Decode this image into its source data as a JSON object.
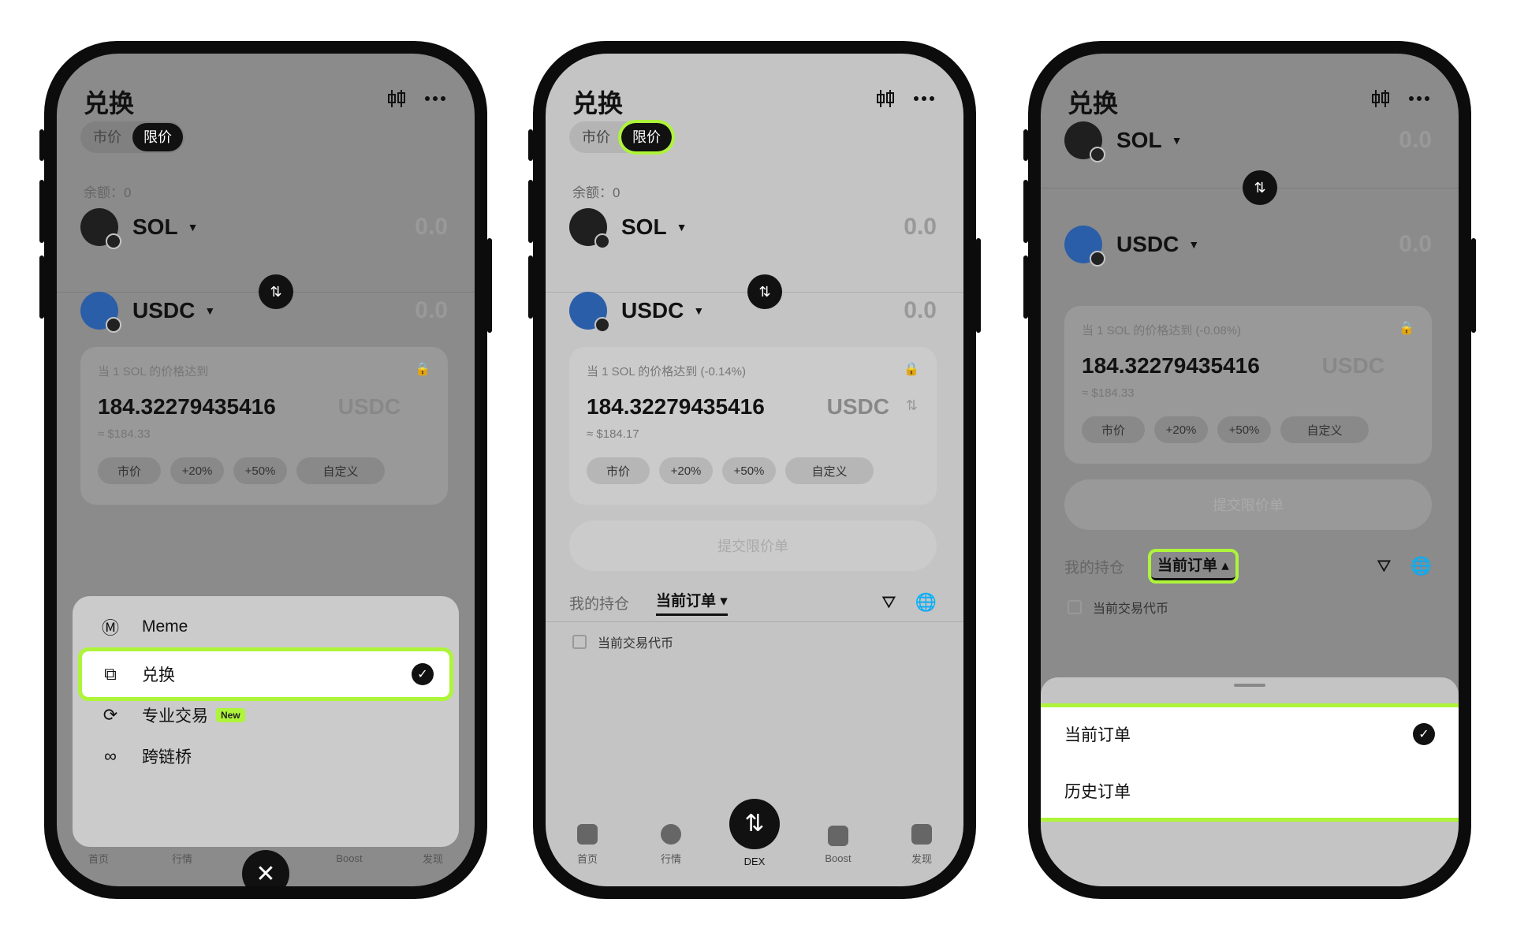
{
  "colors": {
    "highlight": "#aef43a",
    "dark": "#111111",
    "screen_bg": "#c4c4c4"
  },
  "header": {
    "title": "兑换",
    "chart_icon": "candlestick-icon",
    "more_icon": "more-icon"
  },
  "segment": {
    "market": "市价",
    "limit": "限价"
  },
  "balance": "余额：0",
  "tokens": {
    "from": {
      "name": "SOL",
      "amount": "0.0"
    },
    "to": {
      "name": "USDC",
      "amount": "0.0"
    }
  },
  "limit_card": {
    "cond_p1": "当 1 SOL 的价格达到",
    "cond_p2": "当 1 SOL 的价格达到 (-0.14%)",
    "cond_p3": "当 1 SOL 的价格达到 (-0.08%)",
    "price": "184.32279435416",
    "unit": "USDC",
    "usd_p1": "≈ $184.33",
    "usd_p2": "≈ $184.17",
    "usd_p3": "≈ $184.33",
    "chips": [
      "市价",
      "+20%",
      "+50%",
      "自定义"
    ]
  },
  "submit": "提交限价单",
  "order_tabs": {
    "holdings": "我的持仓",
    "current": "当前订单"
  },
  "checkbox_label": "当前交易代币",
  "nav": {
    "home": "首页",
    "market": "行情",
    "dex": "DEX",
    "boost": "Boost",
    "discover": "发现"
  },
  "dex_menu": {
    "items": [
      {
        "label": "Meme",
        "icon": "meme-icon"
      },
      {
        "label": "兑换",
        "icon": "swap-icon"
      },
      {
        "label": "专业交易",
        "icon": "pro-trade-icon",
        "badge": "New"
      },
      {
        "label": "跨链桥",
        "icon": "bridge-icon"
      }
    ]
  },
  "order_sheet": {
    "items": [
      "当前订单",
      "历史订单"
    ]
  }
}
